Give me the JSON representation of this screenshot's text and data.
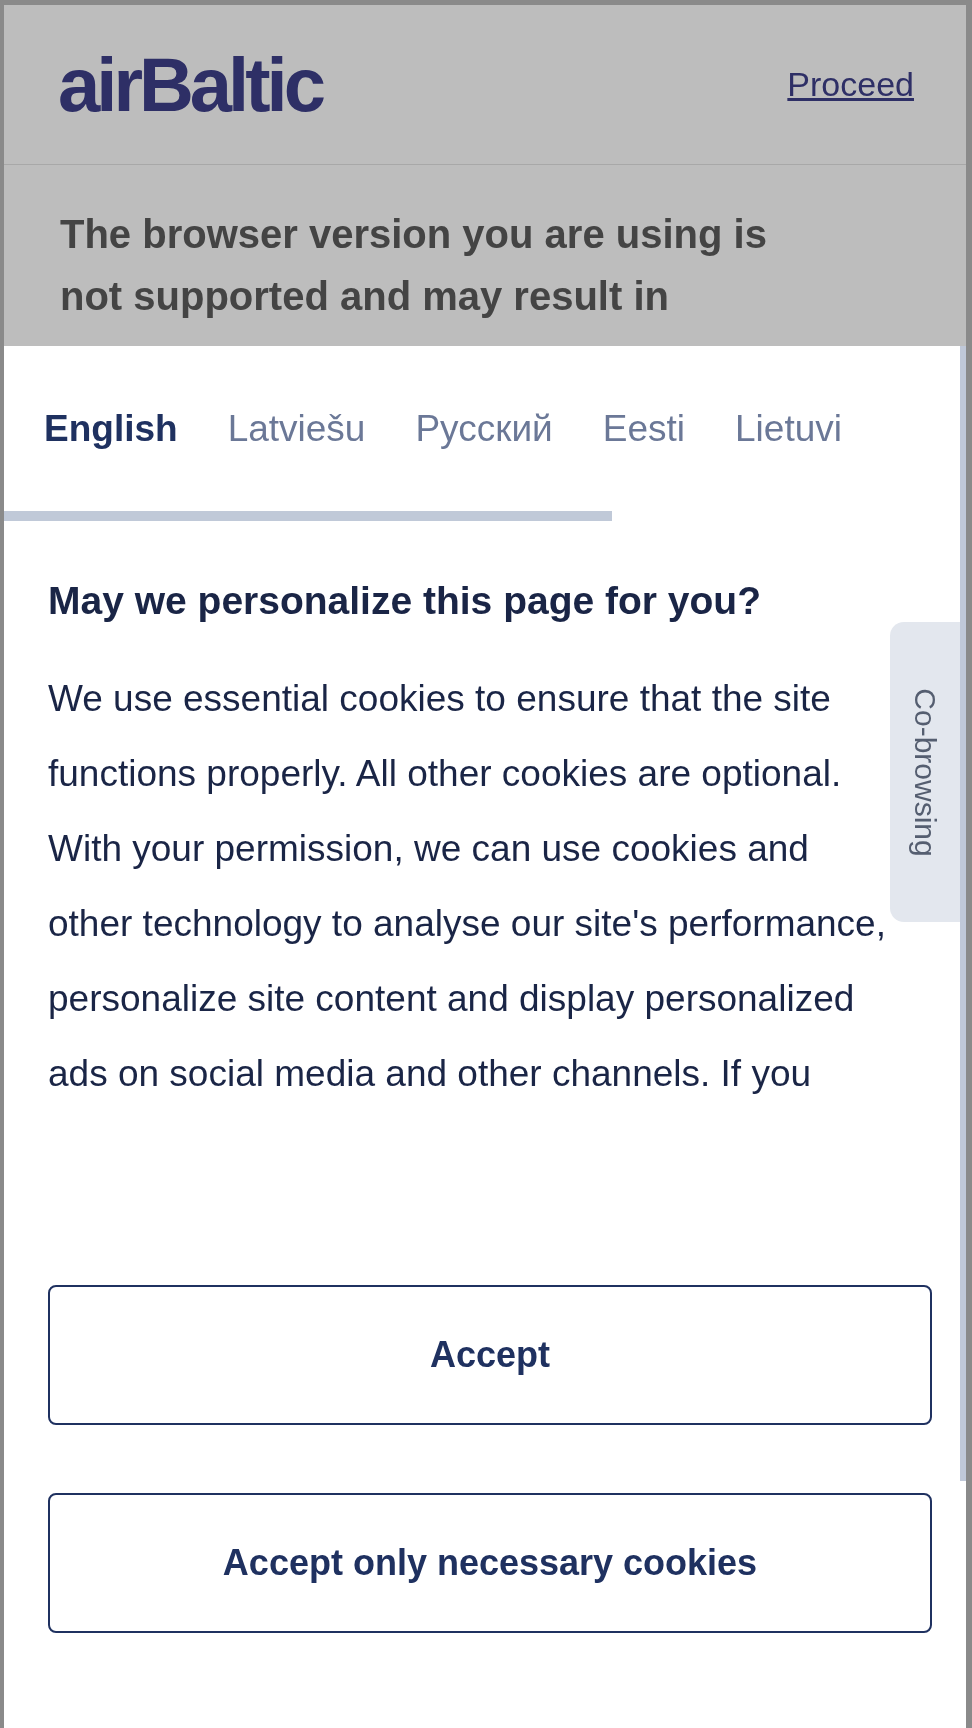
{
  "header": {
    "logo": "airBaltic",
    "proceed_link": "Proceed"
  },
  "warning": "The browser version you are using is not supported and may result in",
  "cookie_dialog": {
    "languages": [
      {
        "label": "English",
        "selected": true
      },
      {
        "label": "Latviešu",
        "selected": false
      },
      {
        "label": "Русский",
        "selected": false
      },
      {
        "label": "Eesti",
        "selected": false
      },
      {
        "label": "Lietuvi",
        "selected": false
      }
    ],
    "title": "May we personalize this page for you?",
    "body": "We use essential cookies to ensure that the site functions properly. All other cookies are optional. With your permission, we can use cookies and other technology to analyse our site's performance, personalize site content and display personalized ads on social media and other channels. If you",
    "buttons": [
      "Accept",
      "Accept only necessary cookies"
    ]
  },
  "side_tab": "Co-browsing"
}
